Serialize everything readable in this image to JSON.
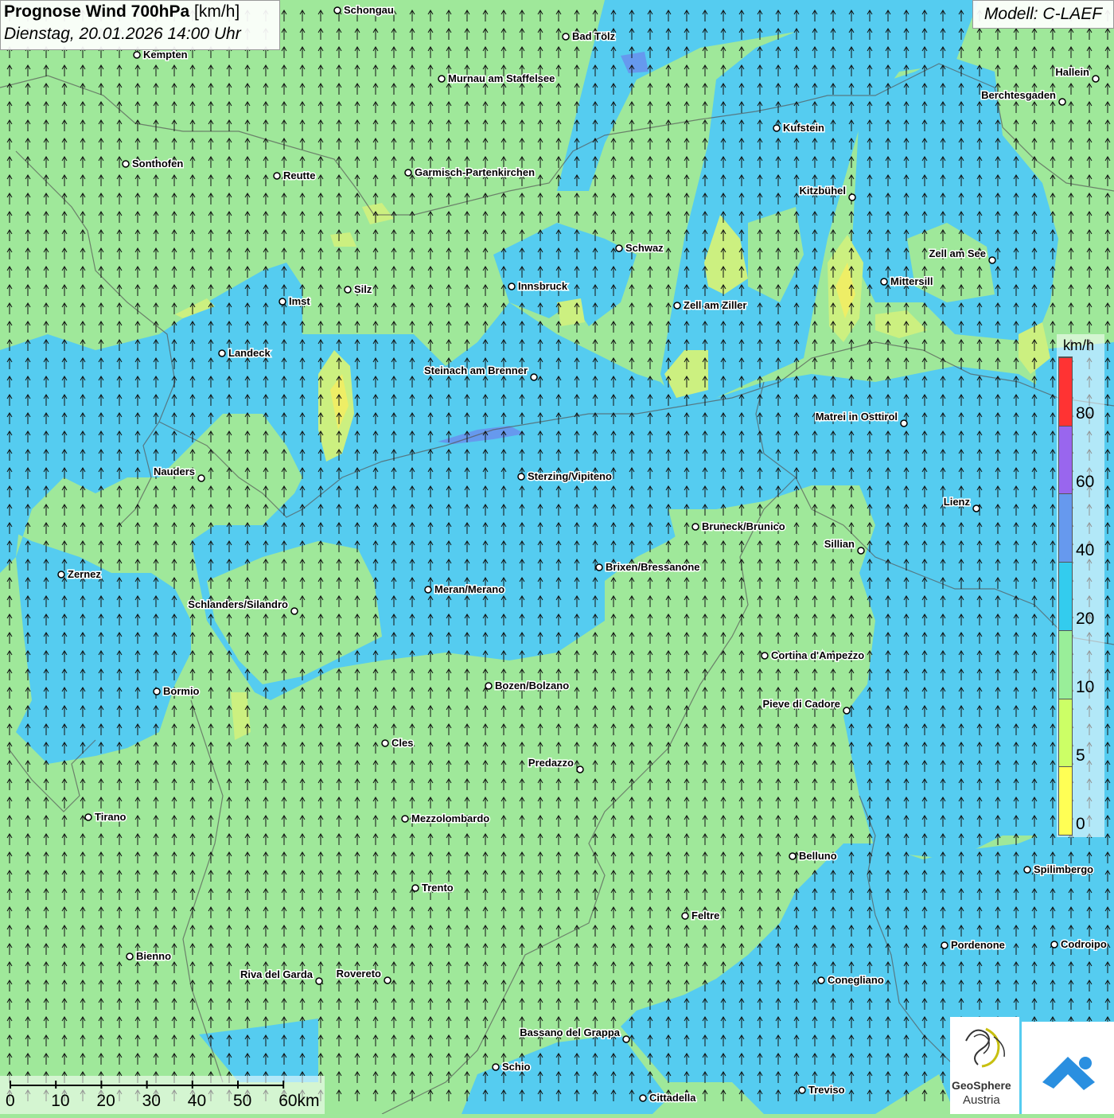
{
  "header": {
    "title_bold": "Prognose Wind 700hPa",
    "title_unit": "[km/h]",
    "datetime": "Dienstag, 20.01.2026 14:00 Uhr"
  },
  "model": {
    "label": "Modell: C-LAEF"
  },
  "legend": {
    "unit": "km/h",
    "ticks": [
      "0",
      "5",
      "10",
      "20",
      "40",
      "60",
      "80"
    ],
    "colors": [
      "#ffff55",
      "#ccff66",
      "#99ee99",
      "#33ccee",
      "#6699ee",
      "#9966ee",
      "#ff3333"
    ]
  },
  "scalebar": {
    "labels": [
      "0",
      "10",
      "20",
      "30",
      "40",
      "50",
      "60km"
    ]
  },
  "cities": [
    {
      "name": "Schongau"
    },
    {
      "name": "Bad Tölz"
    },
    {
      "name": "Kempten"
    },
    {
      "name": "Murnau am Staffelsee"
    },
    {
      "name": "Hallein"
    },
    {
      "name": "Berchtesgaden"
    },
    {
      "name": "Kufstein"
    },
    {
      "name": "Sonthofen"
    },
    {
      "name": "Reutte"
    },
    {
      "name": "Garmisch-Partenkirchen"
    },
    {
      "name": "Kitzbühel"
    },
    {
      "name": "Schwaz"
    },
    {
      "name": "Zell am See"
    },
    {
      "name": "Innsbruck"
    },
    {
      "name": "Mittersill"
    },
    {
      "name": "Silz"
    },
    {
      "name": "Imst"
    },
    {
      "name": "Zell am Ziller"
    },
    {
      "name": "Landeck"
    },
    {
      "name": "Steinach am Brenner"
    },
    {
      "name": "Matrei in Osttirol"
    },
    {
      "name": "Nauders"
    },
    {
      "name": "Sterzing/Vipiteno"
    },
    {
      "name": "Lienz"
    },
    {
      "name": "Bruneck/Brunico"
    },
    {
      "name": "Sillian"
    },
    {
      "name": "Brixen/Bressanone"
    },
    {
      "name": "Zernez"
    },
    {
      "name": "Meran/Merano"
    },
    {
      "name": "Schlanders/Silandro"
    },
    {
      "name": "Cortina d'Ampezzo"
    },
    {
      "name": "Bozen/Bolzano"
    },
    {
      "name": "Bormio"
    },
    {
      "name": "Pieve di Cadore"
    },
    {
      "name": "Cles"
    },
    {
      "name": "Predazzo"
    },
    {
      "name": "Tirano"
    },
    {
      "name": "Mezzolombardo"
    },
    {
      "name": "Belluno"
    },
    {
      "name": "Spilimbergo"
    },
    {
      "name": "Trento"
    },
    {
      "name": "Feltre"
    },
    {
      "name": "Bienno"
    },
    {
      "name": "Pordenone"
    },
    {
      "name": "Codroipo"
    },
    {
      "name": "Riva del Garda"
    },
    {
      "name": "Rovereto"
    },
    {
      "name": "Conegliano"
    },
    {
      "name": "Bassano del Grappa"
    },
    {
      "name": "Schio"
    },
    {
      "name": "Treviso"
    },
    {
      "name": "Cittadella"
    }
  ],
  "logos": {
    "geosphere_line1": "GeoSphere",
    "geosphere_line2": "Austria"
  },
  "colors": {
    "calm": "#9fe89a",
    "moderate": "#55ccf0",
    "strong": "#66aaee",
    "light": "#ccf080",
    "weak": "#eeee66"
  }
}
